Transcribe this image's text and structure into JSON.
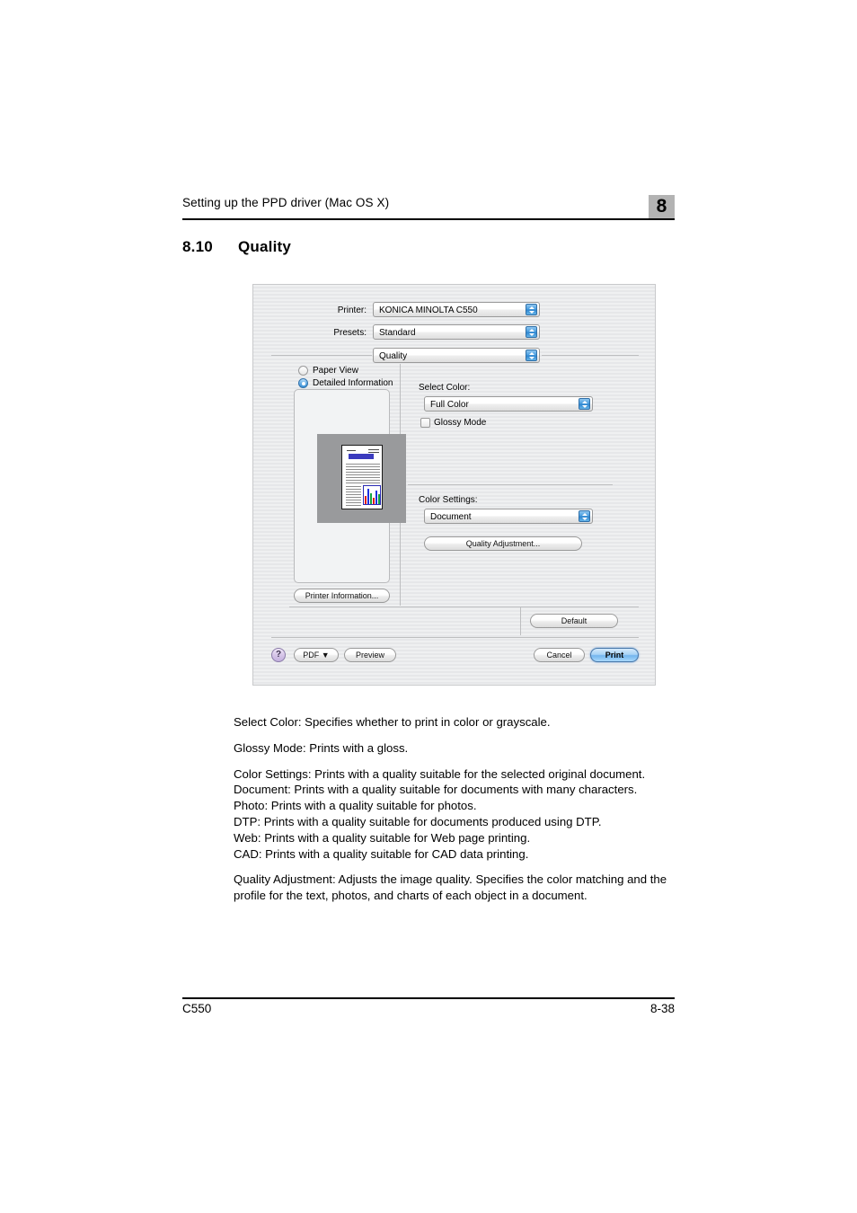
{
  "header": {
    "running_title": "Setting up the PPD driver (Mac OS X)",
    "chapter_badge": "8"
  },
  "section": {
    "number": "8.10",
    "title": "Quality"
  },
  "dialog": {
    "printer_label": "Printer:",
    "printer_value": "KONICA MINOLTA C550",
    "presets_label": "Presets:",
    "presets_value": "Standard",
    "pane_value": "Quality",
    "view_options": [
      {
        "label": "Paper View",
        "selected": false
      },
      {
        "label": "Detailed Information",
        "selected": true
      }
    ],
    "printer_information_button": "Printer Information...",
    "select_color_label": "Select Color:",
    "select_color_value": "Full Color",
    "glossy_mode_label": "Glossy Mode",
    "glossy_mode_checked": false,
    "color_settings_label": "Color Settings:",
    "color_settings_value": "Document",
    "quality_adjustment_button": "Quality Adjustment...",
    "default_button": "Default",
    "help_button": "?",
    "pdf_button": "PDF ▼",
    "preview_button": "Preview",
    "cancel_button": "Cancel",
    "print_button": "Print"
  },
  "body": {
    "p1": "Select Color: Specifies whether to print in color or grayscale.",
    "p2": "Glossy Mode: Prints with a gloss.",
    "p3": "Color Settings: Prints with a quality suitable for the selected original document.",
    "p4": "Document: Prints with a quality suitable for documents with many characters.",
    "p5": "Photo: Prints with a quality suitable for photos.",
    "p6": "DTP: Prints with a quality suitable for documents produced using DTP.",
    "p7": "Web: Prints with a quality suitable for Web page printing.",
    "p8": "CAD: Prints with a quality suitable for CAD data printing.",
    "p9": "Quality Adjustment: Adjusts the image quality. Specifies the color matching and the profile for the text, photos, and charts of each object in a document."
  },
  "footer": {
    "left": "C550",
    "right": "8-38"
  }
}
